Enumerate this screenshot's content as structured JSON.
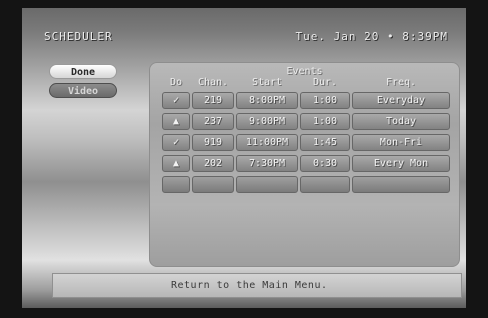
{
  "app_title": "SCHEDULER",
  "datetime": "Tue. Jan 20 • 8:39PM",
  "side_buttons": {
    "done": "Done",
    "video": "Video"
  },
  "events": {
    "title": "Events",
    "columns": {
      "do": "Do",
      "chan": "Chan.",
      "start": "Start",
      "dur": "Dur.",
      "freq": "Freq."
    },
    "rows": [
      {
        "do": "✓",
        "chan": "219",
        "start": "8:00PM",
        "dur": "1:00",
        "freq": "Everyday"
      },
      {
        "do": "▲",
        "chan": "237",
        "start": "9:00PM",
        "dur": "1:00",
        "freq": "Today"
      },
      {
        "do": "✓",
        "chan": "919",
        "start": "11:00PM",
        "dur": "1:45",
        "freq": "Mon-Fri"
      },
      {
        "do": "▲",
        "chan": "202",
        "start": "7:30PM",
        "dur": "0:30",
        "freq": "Every Mon"
      }
    ]
  },
  "status_text": "Return to the Main Menu."
}
